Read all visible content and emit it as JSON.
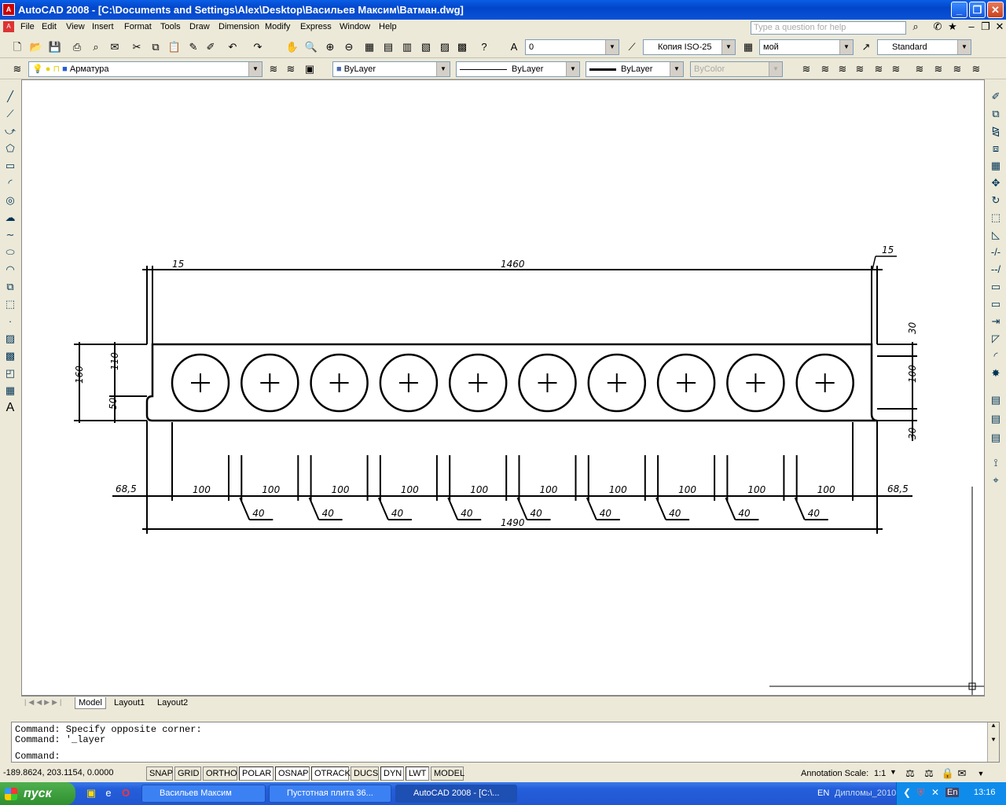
{
  "window": {
    "title": "AutoCAD 2008 - [C:\\Documents and Settings\\Alex\\Desktop\\Васильев Максим\\Ватман.dwg]",
    "app_icon": "autocad-logo-icon"
  },
  "menu": [
    "File",
    "Edit",
    "View",
    "Insert",
    "Format",
    "Tools",
    "Draw",
    "Dimension",
    "Modify",
    "Express",
    "Window",
    "Help"
  ],
  "help_search": {
    "placeholder": "Type a question for help"
  },
  "toolbar_top": {
    "layer_combo": "0",
    "dimstyle_combo": "Копия ISO-25",
    "textstyle_combo": "мой",
    "tablestyle_combo": "Standard"
  },
  "toolbar_props": {
    "layer_name": "Арматура",
    "color": "ByLayer",
    "linetype": "ByLayer",
    "lineweight": "ByLayer",
    "plotstyle": "ByColor"
  },
  "drawing": {
    "dims": {
      "top_left": "15",
      "top_total": "1460",
      "top_right": "15",
      "left_total": "160",
      "left_top": "110",
      "left_bottom": "50",
      "right_top": "30",
      "right_mid": "100",
      "right_bottom": "30",
      "row_left": "68,5",
      "row_right": "68,5",
      "hole_spacing": "100",
      "rib": "40",
      "bottom_total": "1490"
    },
    "hole_count": 10
  },
  "tabs": [
    "Model",
    "Layout1",
    "Layout2"
  ],
  "command": {
    "lines": [
      "Command: Specify opposite corner:",
      "Command: '_layer"
    ],
    "prompt": "Command:"
  },
  "status": {
    "coords": "-189.8624, 203.1154, 0.0000",
    "buttons": [
      "SNAP",
      "GRID",
      "ORTHO",
      "POLAR",
      "OSNAP",
      "OTRACK",
      "DUCS",
      "DYN",
      "LWT",
      "MODEL"
    ],
    "active": [
      "POLAR",
      "OSNAP",
      "OTRACK",
      "DYN",
      "LWT"
    ],
    "annotation_label": "Annotation Scale:",
    "annotation_value": "1:1"
  },
  "taskbar": {
    "start": "пуск",
    "tasks": [
      "Васильев Максим",
      "Пустотная плита 36...",
      "AutoCAD 2008 - [C:\\..."
    ],
    "lang": "EN",
    "folder": "Дипломы_2010",
    "lang2": "En",
    "time": "13:16"
  }
}
